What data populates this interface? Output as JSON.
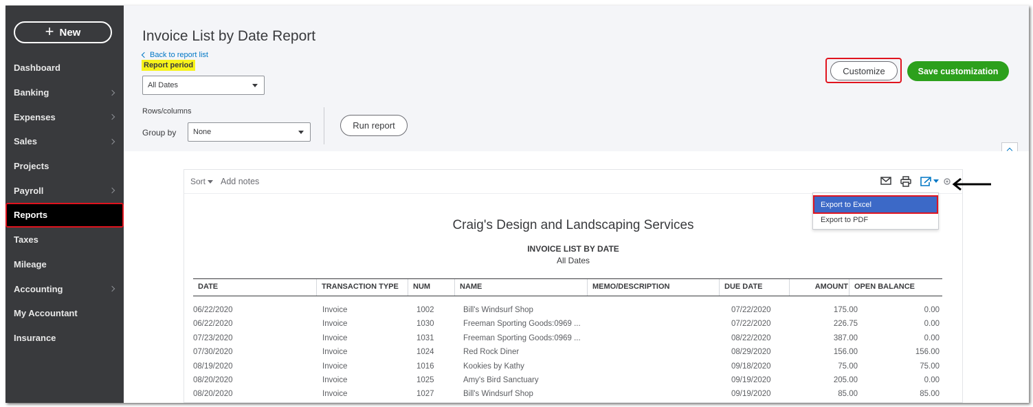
{
  "sidebar": {
    "new_label": "New",
    "items": [
      {
        "label": "Dashboard",
        "has_submenu": false,
        "active": false
      },
      {
        "label": "Banking",
        "has_submenu": true,
        "active": false
      },
      {
        "label": "Expenses",
        "has_submenu": true,
        "active": false
      },
      {
        "label": "Sales",
        "has_submenu": true,
        "active": false
      },
      {
        "label": "Projects",
        "has_submenu": false,
        "active": false
      },
      {
        "label": "Payroll",
        "has_submenu": true,
        "active": false
      },
      {
        "label": "Reports",
        "has_submenu": false,
        "active": true
      },
      {
        "label": "Taxes",
        "has_submenu": false,
        "active": false
      },
      {
        "label": "Mileage",
        "has_submenu": false,
        "active": false
      },
      {
        "label": "Accounting",
        "has_submenu": true,
        "active": false
      },
      {
        "label": "My Accountant",
        "has_submenu": false,
        "active": false
      },
      {
        "label": "Insurance",
        "has_submenu": false,
        "active": false
      }
    ]
  },
  "header": {
    "title": "Invoice List by Date Report",
    "back_link": "Back to report list",
    "report_period_label": "Report period",
    "report_period_value": "All Dates",
    "rows_columns_label": "Rows/columns",
    "group_by_label": "Group by",
    "group_by_value": "None",
    "run_report": "Run report",
    "customize": "Customize",
    "save_customization": "Save customization"
  },
  "toolbar": {
    "sort_label": "Sort",
    "add_notes_label": "Add notes",
    "icons": [
      "email-icon",
      "print-icon",
      "export-icon",
      "settings-icon"
    ]
  },
  "export_menu": {
    "excel": "Export to Excel",
    "pdf": "Export to PDF"
  },
  "report": {
    "company": "Craig's Design and Landscaping Services",
    "title": "INVOICE LIST BY DATE",
    "subtitle": "All Dates",
    "columns": [
      "DATE",
      "TRANSACTION TYPE",
      "NUM",
      "NAME",
      "MEMO/DESCRIPTION",
      "DUE DATE",
      "AMOUNT",
      "OPEN BALANCE"
    ],
    "rows": [
      [
        "06/22/2020",
        "Invoice",
        "1002",
        "Bill's Windsurf Shop",
        "",
        "07/22/2020",
        "175.00",
        "0.00"
      ],
      [
        "06/22/2020",
        "Invoice",
        "1030",
        "Freeman Sporting Goods:0969 ...",
        "",
        "07/22/2020",
        "226.75",
        "0.00"
      ],
      [
        "07/23/2020",
        "Invoice",
        "1031",
        "Freeman Sporting Goods:0969 ...",
        "",
        "08/22/2020",
        "387.00",
        "0.00"
      ],
      [
        "07/30/2020",
        "Invoice",
        "1024",
        "Red Rock Diner",
        "",
        "08/29/2020",
        "156.00",
        "156.00"
      ],
      [
        "08/19/2020",
        "Invoice",
        "1016",
        "Kookies by Kathy",
        "",
        "09/18/2020",
        "75.00",
        "75.00"
      ],
      [
        "08/20/2020",
        "Invoice",
        "1025",
        "Amy's Bird Sanctuary",
        "",
        "09/19/2020",
        "205.00",
        "0.00"
      ],
      [
        "08/20/2020",
        "Invoice",
        "1027",
        "Bill's Windsurf Shop",
        "",
        "09/19/2020",
        "85.00",
        "85.00"
      ]
    ]
  },
  "colors": {
    "sidebar_bg": "#393a3d",
    "accent_green": "#2ca01c",
    "link_blue": "#0077c5",
    "highlight_red": "#e0131e",
    "highlight_yellow": "#f7f31a",
    "menu_selected": "#3c69c7"
  }
}
